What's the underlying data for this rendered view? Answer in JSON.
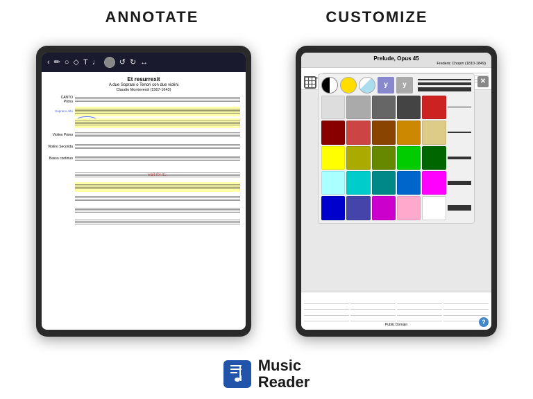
{
  "header": {
    "annotate_label": "ANNOTATE",
    "customize_label": "CUSTOMIZE"
  },
  "left_tablet": {
    "score_title": "Et resurrexit",
    "score_subtitle": "A due Soprani o Tenori con due violini",
    "score_composer": "Claudio Monteverdi (1567-1643)",
    "parts": [
      {
        "label": "CANTO Primo"
      },
      {
        "label": "Soprano Alto",
        "highlight": true
      },
      {
        "label": ""
      },
      {
        "label": "Violino Primo"
      },
      {
        "label": "Violino Seconda"
      },
      {
        "label": "Basso continuo"
      }
    ],
    "wait_text": "wait for it..."
  },
  "right_tablet": {
    "score_title": "Prelude, Opus 45",
    "score_composer": "Frederic Chopin (1810-1849)",
    "bottom_label": "Public Domain",
    "colors": [
      {
        "color": "#ffffff",
        "type": "color"
      },
      {
        "color": "#ffdd00",
        "type": "color"
      },
      {
        "color": "#aaddee",
        "type": "color"
      },
      {
        "color": "#8888cc",
        "type": "y"
      },
      {
        "color": "#aaaaaa",
        "type": "y"
      },
      {
        "color": "#ffffff",
        "type": "line"
      },
      {
        "color": "#dddddd",
        "type": "color"
      },
      {
        "color": "#aaaaaa",
        "type": "color"
      },
      {
        "color": "#666666",
        "type": "color"
      },
      {
        "color": "#444444",
        "type": "color"
      },
      {
        "color": "#cc2222",
        "type": "color"
      },
      {
        "color": "#ffffff",
        "type": "line"
      },
      {
        "color": "#880000",
        "type": "color"
      },
      {
        "color": "#cc4444",
        "type": "color"
      },
      {
        "color": "#884400",
        "type": "color"
      },
      {
        "color": "#cc8800",
        "type": "color"
      },
      {
        "color": "#ddcc88",
        "type": "color"
      },
      {
        "color": "#ffffff",
        "type": "line"
      },
      {
        "color": "#ffff00",
        "type": "color"
      },
      {
        "color": "#aaaa00",
        "type": "color"
      },
      {
        "color": "#668800",
        "type": "color"
      },
      {
        "color": "#00cc00",
        "type": "color"
      },
      {
        "color": "#006600",
        "type": "color"
      },
      {
        "color": "#ffffff",
        "type": "line"
      },
      {
        "color": "#aaffff",
        "type": "color"
      },
      {
        "color": "#00cccc",
        "type": "color"
      },
      {
        "color": "#008888",
        "type": "color"
      },
      {
        "color": "#0066cc",
        "type": "color"
      },
      {
        "color": "#ff00ff",
        "type": "color"
      },
      {
        "color": "#ffffff",
        "type": "line"
      },
      {
        "color": "#0000cc",
        "type": "color"
      },
      {
        "color": "#4444aa",
        "type": "color"
      },
      {
        "color": "#cc00cc",
        "type": "color"
      },
      {
        "color": "#ffaacc",
        "type": "color"
      },
      {
        "color": "#ffffff",
        "type": "color"
      },
      {
        "color": "#000000",
        "type": "line"
      }
    ]
  },
  "footer": {
    "logo_icon": "♩",
    "app_name_line1": "Music",
    "app_name_line2": "Reader"
  }
}
